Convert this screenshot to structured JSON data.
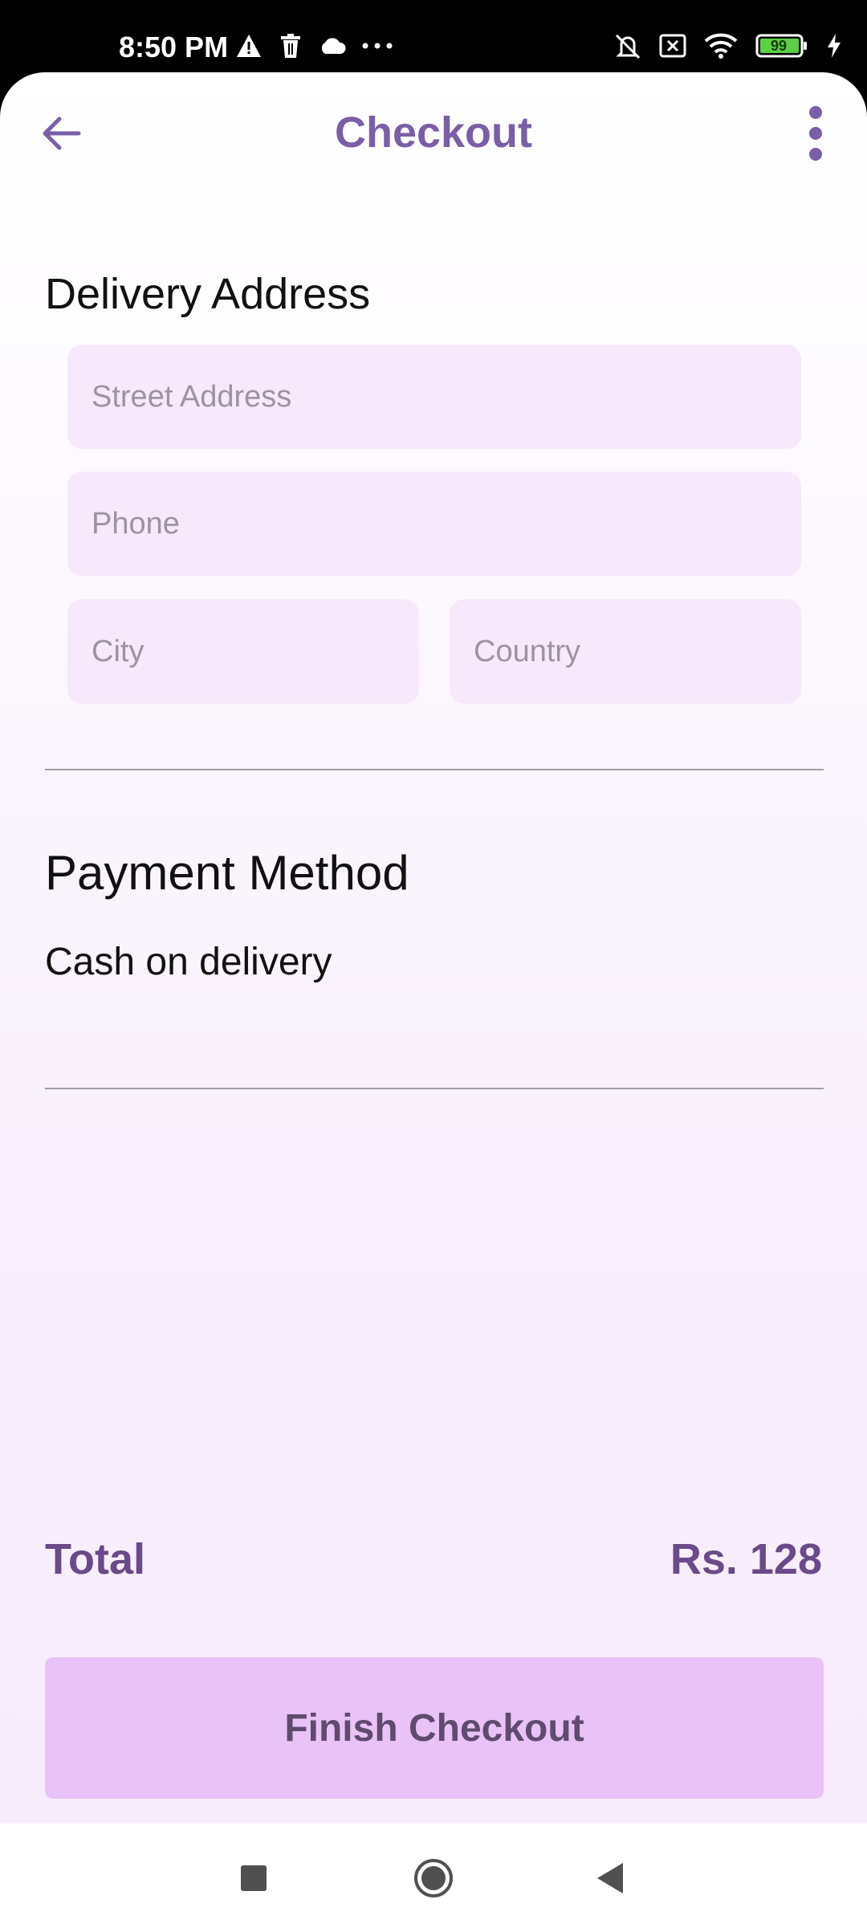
{
  "status_bar": {
    "time": "8:50 PM",
    "battery": "99",
    "icons": [
      "alert-icon",
      "trash-icon",
      "cloud-icon",
      "more-dots-icon",
      "mute-icon",
      "sim-x-icon",
      "wifi-icon",
      "battery-icon",
      "charging-icon"
    ]
  },
  "header": {
    "title": "Checkout",
    "back_icon": "arrow-left-icon",
    "menu_icon": "more-vert-icon",
    "accent_color": "#7a5ea8"
  },
  "delivery": {
    "title": "Delivery Address",
    "street": {
      "placeholder": "Street Address",
      "value": ""
    },
    "phone": {
      "placeholder": "Phone",
      "value": ""
    },
    "city": {
      "placeholder": "City",
      "value": ""
    },
    "country": {
      "placeholder": "Country",
      "value": ""
    }
  },
  "payment": {
    "title": "Payment Method",
    "method": "Cash on delivery"
  },
  "summary": {
    "total_label": "Total",
    "total_value": "Rs. 128"
  },
  "actions": {
    "finish_label": "Finish Checkout",
    "button_color": "#e9c2f8"
  },
  "nav": {
    "icons": [
      "recents-square-icon",
      "home-circle-icon",
      "back-triangle-icon"
    ]
  }
}
